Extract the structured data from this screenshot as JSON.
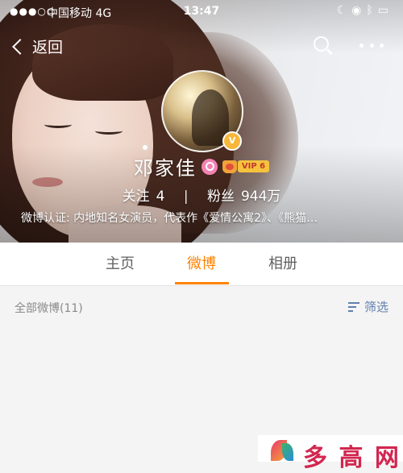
{
  "status_bar": {
    "signal": "●●●○○",
    "carrier": "中国移动  4G",
    "time": "13:47"
  },
  "nav": {
    "back_label": "返回"
  },
  "profile": {
    "name": "邓家佳",
    "vip_label": "VIP 6",
    "verified_mark": "V",
    "follow_label": "关注",
    "follow_count": "4",
    "fans_label": "粉丝",
    "fans_count": "944万",
    "verification": "微博认证: 内地知名女演员，代表作《爱情公寓2》、《熊猫…"
  },
  "tabs": [
    {
      "label": "主页"
    },
    {
      "label": "微博",
      "active": true
    },
    {
      "label": "相册"
    }
  ],
  "filter": {
    "title": "全部微博(11)",
    "button_label": "筛选"
  },
  "watermark": {
    "text": "多 高 网"
  },
  "colors": {
    "accent": "#ff8200",
    "link": "#5f7fae",
    "gender_female": "#f383b3",
    "vip_gold": "#f6c23e"
  }
}
